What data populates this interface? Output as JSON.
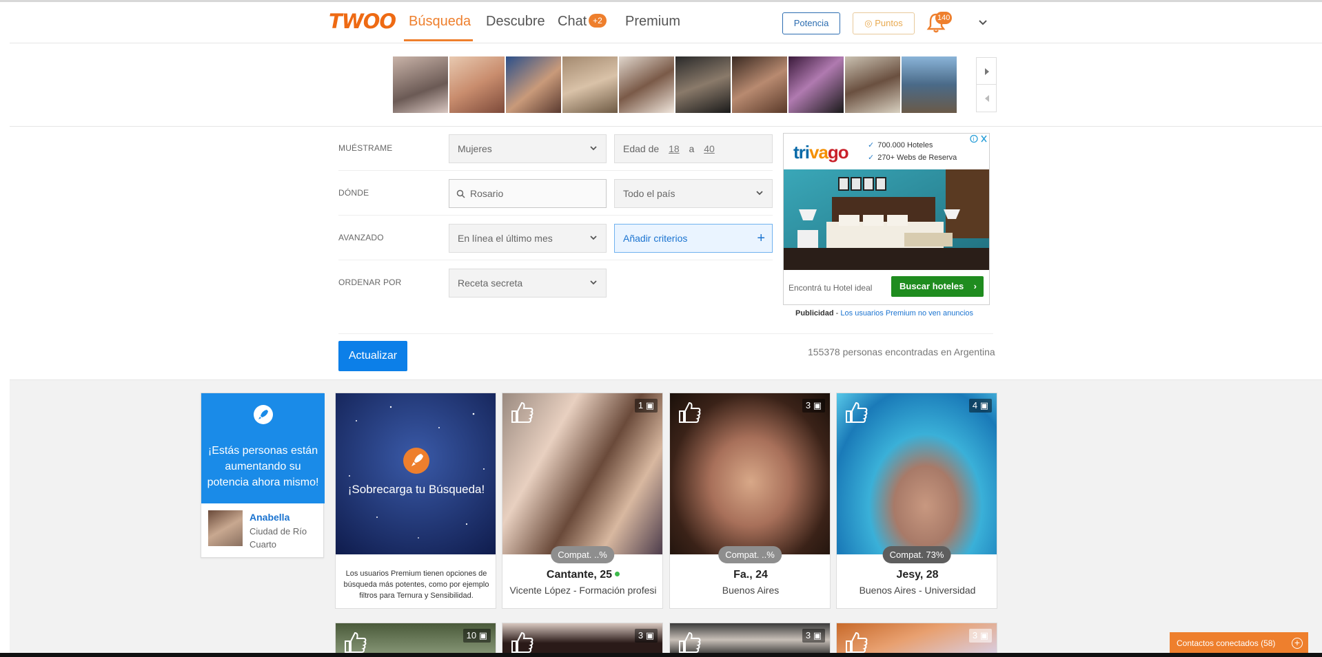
{
  "header": {
    "logo": "TWOO",
    "nav": [
      "Búsqueda",
      "Descubre",
      "Chat",
      "Premium"
    ],
    "chat_badge": "+2",
    "potencia_label": "Potencia",
    "puntos_label": "Puntos",
    "notifications_count": "140",
    "accent": "#ee7f2d"
  },
  "filters": {
    "show_label": "MUÉSTRAME",
    "show_value": "Mujeres",
    "age_prefix": "Edad de",
    "age_from": "18",
    "age_sep": "a",
    "age_to": "40",
    "where_label": "DÓNDE",
    "location_value": "Rosario",
    "region_value": "Todo el país",
    "advanced_label": "AVANZADO",
    "activity_value": "En línea el último mes",
    "add_criteria": "Añadir criterios",
    "sort_label": "ORDENAR POR",
    "sort_value": "Receta secreta"
  },
  "ad": {
    "brand": "trivago",
    "feature_1": "700.000 Hoteles",
    "feature_2": "270+ Webs de Reserva",
    "footer_text": "Encontrá tu Hotel ideal",
    "button": "Buscar hoteles",
    "note_prefix": "Publicidad",
    "note_link": "Los usuarios Premium no ven anuncios"
  },
  "results": {
    "update_button": "Actualizar",
    "count_text": "155378 personas encontradas en Argentina"
  },
  "boost": {
    "text": "¡Estás personas están aumentando su potencia ahora mismo!",
    "user_name": "Anabella",
    "user_location": "Ciudad de Río Cuarto"
  },
  "premium_card": {
    "title": "¡Sobrecarga tu Búsqueda!",
    "description": "Los usuarios Premium tienen opciones de búsqueda más potentes, como por ejemplo filtros para Ternura y Sensibilidad."
  },
  "cards": [
    {
      "photos": "1",
      "compat": "Compat. ..%",
      "name": "Cantante, 25",
      "location": "Vicente López - Formación profesi"
    },
    {
      "photos": "3",
      "compat": "Compat. ..%",
      "name": "Fa., 24",
      "location": "Buenos Aires"
    },
    {
      "photos": "4",
      "compat": "Compat. 73%",
      "name": "Jesy, 28",
      "location": "Buenos Aires - Universidad"
    }
  ],
  "row2_counts": [
    "10",
    "3",
    "3",
    "3"
  ],
  "contacts_bar": "Contactos conectados (58)"
}
